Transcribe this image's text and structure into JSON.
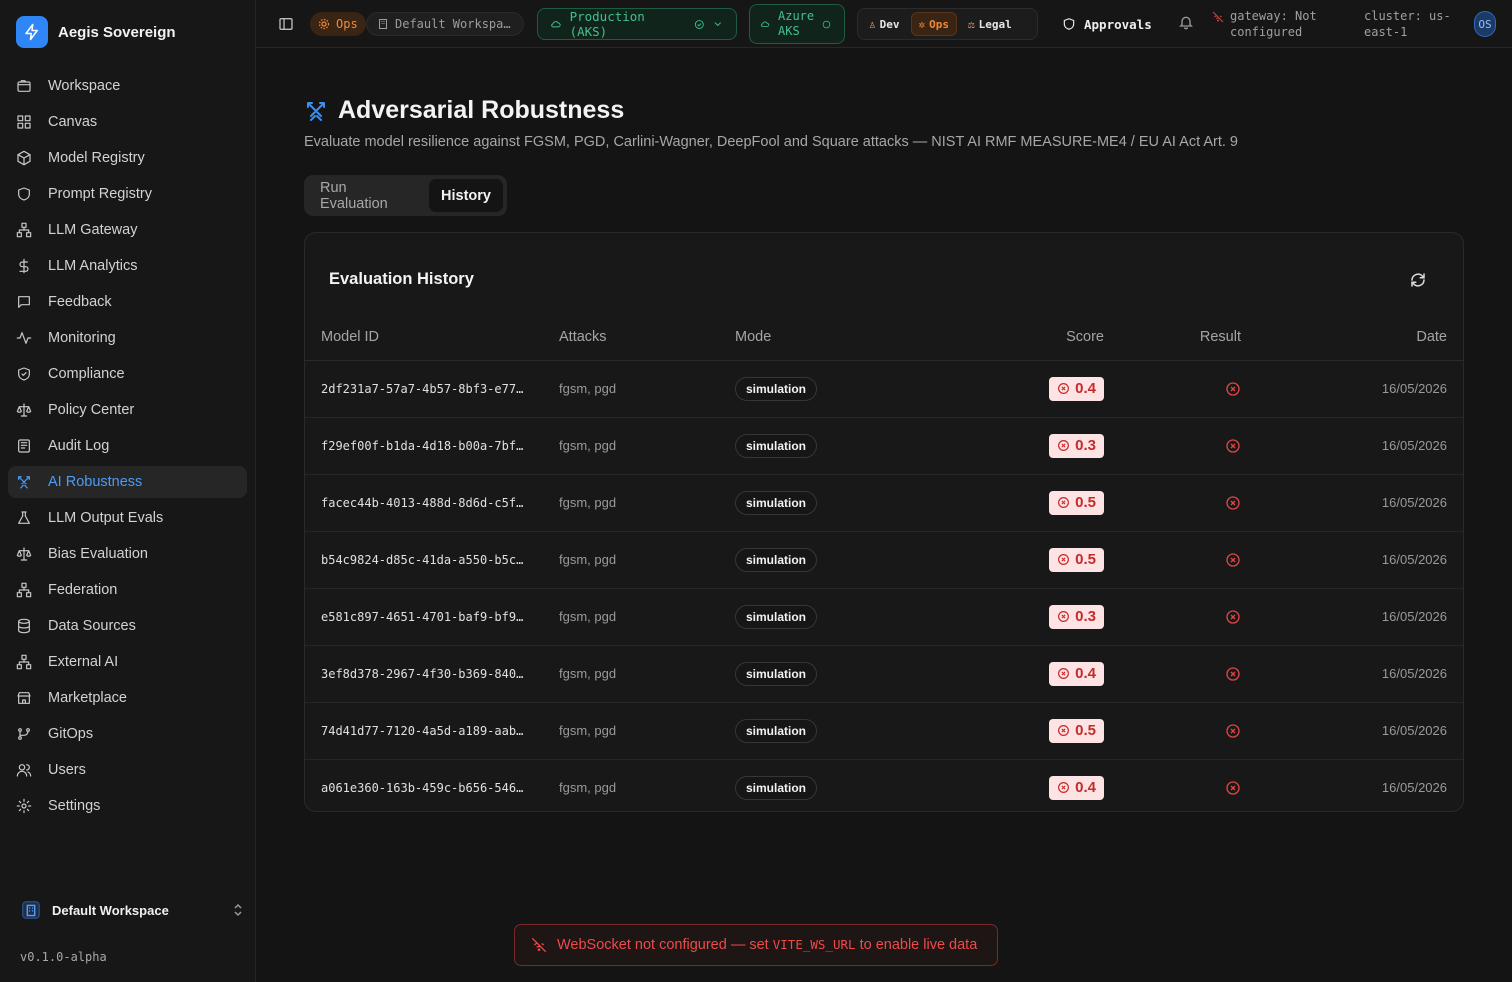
{
  "brand": {
    "name": "Aegis Sovereign"
  },
  "sidebar": {
    "items": [
      {
        "label": "Workspace",
        "icon": "folder-icon"
      },
      {
        "label": "Canvas",
        "icon": "grid-icon"
      },
      {
        "label": "Model Registry",
        "icon": "cube-icon"
      },
      {
        "label": "Prompt Registry",
        "icon": "shield-icon"
      },
      {
        "label": "LLM Gateway",
        "icon": "network-icon"
      },
      {
        "label": "LLM Analytics",
        "icon": "dollar-icon"
      },
      {
        "label": "Feedback",
        "icon": "message-icon"
      },
      {
        "label": "Monitoring",
        "icon": "activity-icon"
      },
      {
        "label": "Compliance",
        "icon": "shield-check-icon"
      },
      {
        "label": "Policy Center",
        "icon": "scale-icon"
      },
      {
        "label": "Audit Log",
        "icon": "log-icon"
      },
      {
        "label": "AI Robustness",
        "icon": "swords-icon",
        "active": true
      },
      {
        "label": "LLM Output Evals",
        "icon": "flask-icon"
      },
      {
        "label": "Bias Evaluation",
        "icon": "scale-icon"
      },
      {
        "label": "Federation",
        "icon": "network-icon"
      },
      {
        "label": "Data Sources",
        "icon": "database-icon"
      },
      {
        "label": "External AI",
        "icon": "network-icon"
      },
      {
        "label": "Marketplace",
        "icon": "store-icon"
      },
      {
        "label": "GitOps",
        "icon": "git-branch-icon"
      },
      {
        "label": "Users",
        "icon": "users-icon"
      },
      {
        "label": "Settings",
        "icon": "gear-icon"
      }
    ],
    "workspace": "Default Workspace",
    "version": "v0.1.0-alpha"
  },
  "topbar": {
    "ops_pill": "Ops",
    "workspace_pill": "Default Workspa…",
    "environment": "Production (AKS)",
    "cloud_line1": "Azure",
    "cloud_line2": "AKS",
    "personas": [
      "Dev",
      "Ops",
      "Legal"
    ],
    "active_persona": "Ops",
    "approvals": "Approvals",
    "gateway_line1": "gateway: Not",
    "gateway_line2": "configured",
    "cluster_line1": "cluster: us-",
    "cluster_line2": "east-1",
    "avatar": "OS"
  },
  "page": {
    "title": "Adversarial Robustness",
    "subtitle": "Evaluate model resilience against FGSM, PGD, Carlini-Wagner, DeepFool and Square attacks — NIST AI RMF MEASURE-ME4 / EU AI Act Art. 9",
    "tabs": [
      "Run Evaluation",
      "History"
    ],
    "active_tab": "History"
  },
  "history": {
    "title": "Evaluation History",
    "columns": [
      "Model ID",
      "Attacks",
      "Mode",
      "Score",
      "Result",
      "Date"
    ],
    "rows": [
      {
        "model_id": "2df231a7-57a7-4b57-8bf3-e77…",
        "attacks": "fgsm, pgd",
        "mode": "simulation",
        "score": "0.4",
        "date": "16/05/2026"
      },
      {
        "model_id": "f29ef00f-b1da-4d18-b00a-7bf…",
        "attacks": "fgsm, pgd",
        "mode": "simulation",
        "score": "0.3",
        "date": "16/05/2026"
      },
      {
        "model_id": "facec44b-4013-488d-8d6d-c5f…",
        "attacks": "fgsm, pgd",
        "mode": "simulation",
        "score": "0.5",
        "date": "16/05/2026"
      },
      {
        "model_id": "b54c9824-d85c-41da-a550-b5c…",
        "attacks": "fgsm, pgd",
        "mode": "simulation",
        "score": "0.5",
        "date": "16/05/2026"
      },
      {
        "model_id": "e581c897-4651-4701-baf9-bf9…",
        "attacks": "fgsm, pgd",
        "mode": "simulation",
        "score": "0.3",
        "date": "16/05/2026"
      },
      {
        "model_id": "3ef8d378-2967-4f30-b369-840…",
        "attacks": "fgsm, pgd",
        "mode": "simulation",
        "score": "0.4",
        "date": "16/05/2026"
      },
      {
        "model_id": "74d41d77-7120-4a5d-a189-aab…",
        "attacks": "fgsm, pgd",
        "mode": "simulation",
        "score": "0.5",
        "date": "16/05/2026"
      },
      {
        "model_id": "a061e360-163b-459c-b656-546…",
        "attacks": "fgsm, pgd",
        "mode": "simulation",
        "score": "0.4",
        "date": "16/05/2026"
      }
    ]
  },
  "toast": {
    "before": "WebSocket not configured — set ",
    "code": "VITE_WS_URL",
    "after": " to enable live data"
  },
  "colors": {
    "accent": "#2f86f6",
    "ops": "#f08a3a",
    "env": "#43c08d",
    "error": "#ee4a4a"
  }
}
